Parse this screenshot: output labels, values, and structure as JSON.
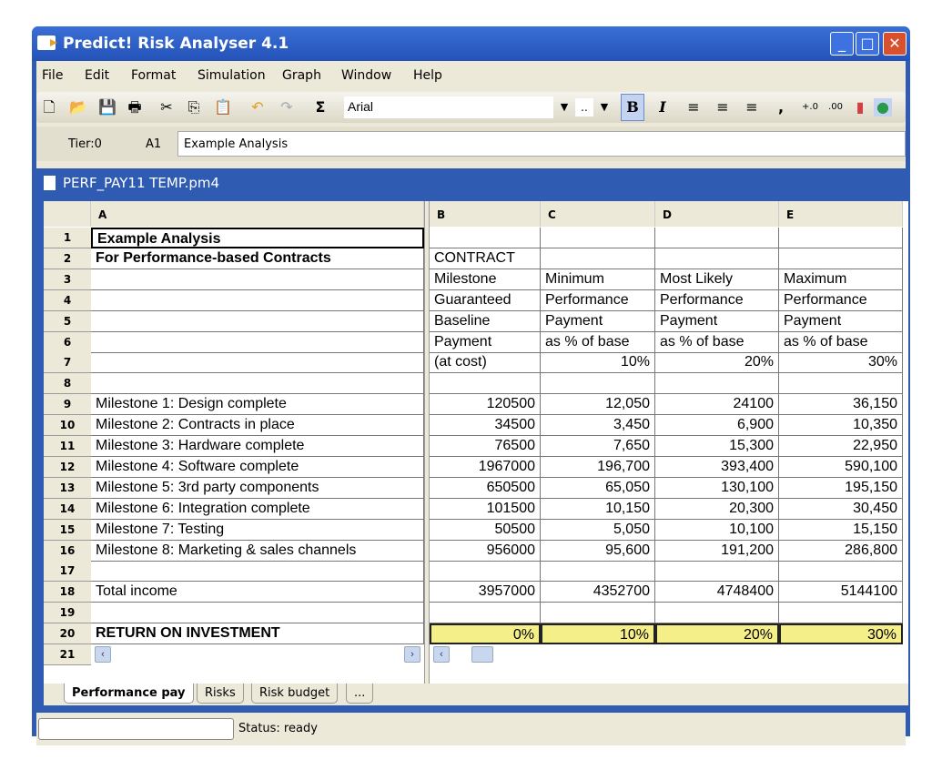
{
  "app": {
    "title": "Predict! Risk Analyser 4.1"
  },
  "menu": [
    "File",
    "Edit",
    "Format",
    "Simulation",
    "Graph",
    "Window",
    "Help"
  ],
  "toolbar": {
    "font": "Arial",
    "size": "..",
    "bold": "B",
    "italic": "I",
    "sum": "Σ",
    "comma": ","
  },
  "formula": {
    "tier": "Tier:0",
    "cell_ref": "A1",
    "value": "Example Analysis"
  },
  "document": {
    "title": "PERF_PAY11 TEMP.pm4"
  },
  "sheet": {
    "columns": [
      "A",
      "B",
      "C",
      "D",
      "E"
    ],
    "rows": [
      {
        "n": "1",
        "a": "Example Analysis",
        "b": "",
        "c": "",
        "d": "",
        "e": ""
      },
      {
        "n": "2",
        "a": "For Performance-based Contracts",
        "b": "CONTRACT",
        "c": "",
        "d": "",
        "e": ""
      },
      {
        "n": "3",
        "a": "",
        "b": "Milestone",
        "c": "Minimum",
        "d": "Most Likely",
        "e": "Maximum"
      },
      {
        "n": "4",
        "a": "",
        "b": "Guaranteed",
        "c": "Performance",
        "d": "Performance",
        "e": "Performance"
      },
      {
        "n": "5",
        "a": "",
        "b": "Baseline",
        "c": "Payment",
        "d": "Payment",
        "e": "Payment"
      },
      {
        "n": "6",
        "a": "",
        "b": "Payment",
        "c": "as % of base",
        "d": "as % of base",
        "e": "as % of base"
      },
      {
        "n": "7",
        "a": "",
        "b": "(at cost)",
        "c": "10%",
        "d": "20%",
        "e": "30%"
      },
      {
        "n": "8",
        "a": "",
        "b": "",
        "c": "",
        "d": "",
        "e": ""
      },
      {
        "n": "9",
        "a": "Milestone 1:  Design complete",
        "b": "120500",
        "c": "12,050",
        "d": "24100",
        "e": "36,150"
      },
      {
        "n": "10",
        "a": "Milestone 2:  Contracts in place",
        "b": "34500",
        "c": "3,450",
        "d": "6,900",
        "e": "10,350"
      },
      {
        "n": "11",
        "a": "Milestone 3:  Hardware complete",
        "b": "76500",
        "c": "7,650",
        "d": "15,300",
        "e": "22,950"
      },
      {
        "n": "12",
        "a": "Milestone 4:  Software complete",
        "b": "1967000",
        "c": "196,700",
        "d": "393,400",
        "e": "590,100"
      },
      {
        "n": "13",
        "a": "Milestone 5:  3rd party components",
        "b": "650500",
        "c": "65,050",
        "d": "130,100",
        "e": "195,150"
      },
      {
        "n": "14",
        "a": "Milestone 6:  Integration complete",
        "b": "101500",
        "c": "10,150",
        "d": "20,300",
        "e": "30,450"
      },
      {
        "n": "15",
        "a": "Milestone 7:  Testing",
        "b": "50500",
        "c": "5,050",
        "d": "10,100",
        "e": "15,150"
      },
      {
        "n": "16",
        "a": "Milestone 8:  Marketing & sales channels",
        "b": "956000",
        "c": "95,600",
        "d": "191,200",
        "e": "286,800"
      },
      {
        "n": "17",
        "a": "",
        "b": "",
        "c": "",
        "d": "",
        "e": ""
      },
      {
        "n": "18",
        "a": "Total income",
        "b": "3957000",
        "c": "4352700",
        "d": "4748400",
        "e": "5144100"
      },
      {
        "n": "19",
        "a": "",
        "b": "",
        "c": "",
        "d": "",
        "e": ""
      },
      {
        "n": "20",
        "a": "RETURN ON INVESTMENT",
        "b": "0%",
        "c": "10%",
        "d": "20%",
        "e": "30%"
      }
    ],
    "last_row": "21",
    "highlight_color": "#f5ef8a"
  },
  "tabs": [
    {
      "label": "Performance pay",
      "active": true
    },
    {
      "label": "Risks"
    },
    {
      "label": "Risk budget"
    },
    {
      "label": "..."
    }
  ],
  "status": {
    "text": "Status: ready"
  }
}
